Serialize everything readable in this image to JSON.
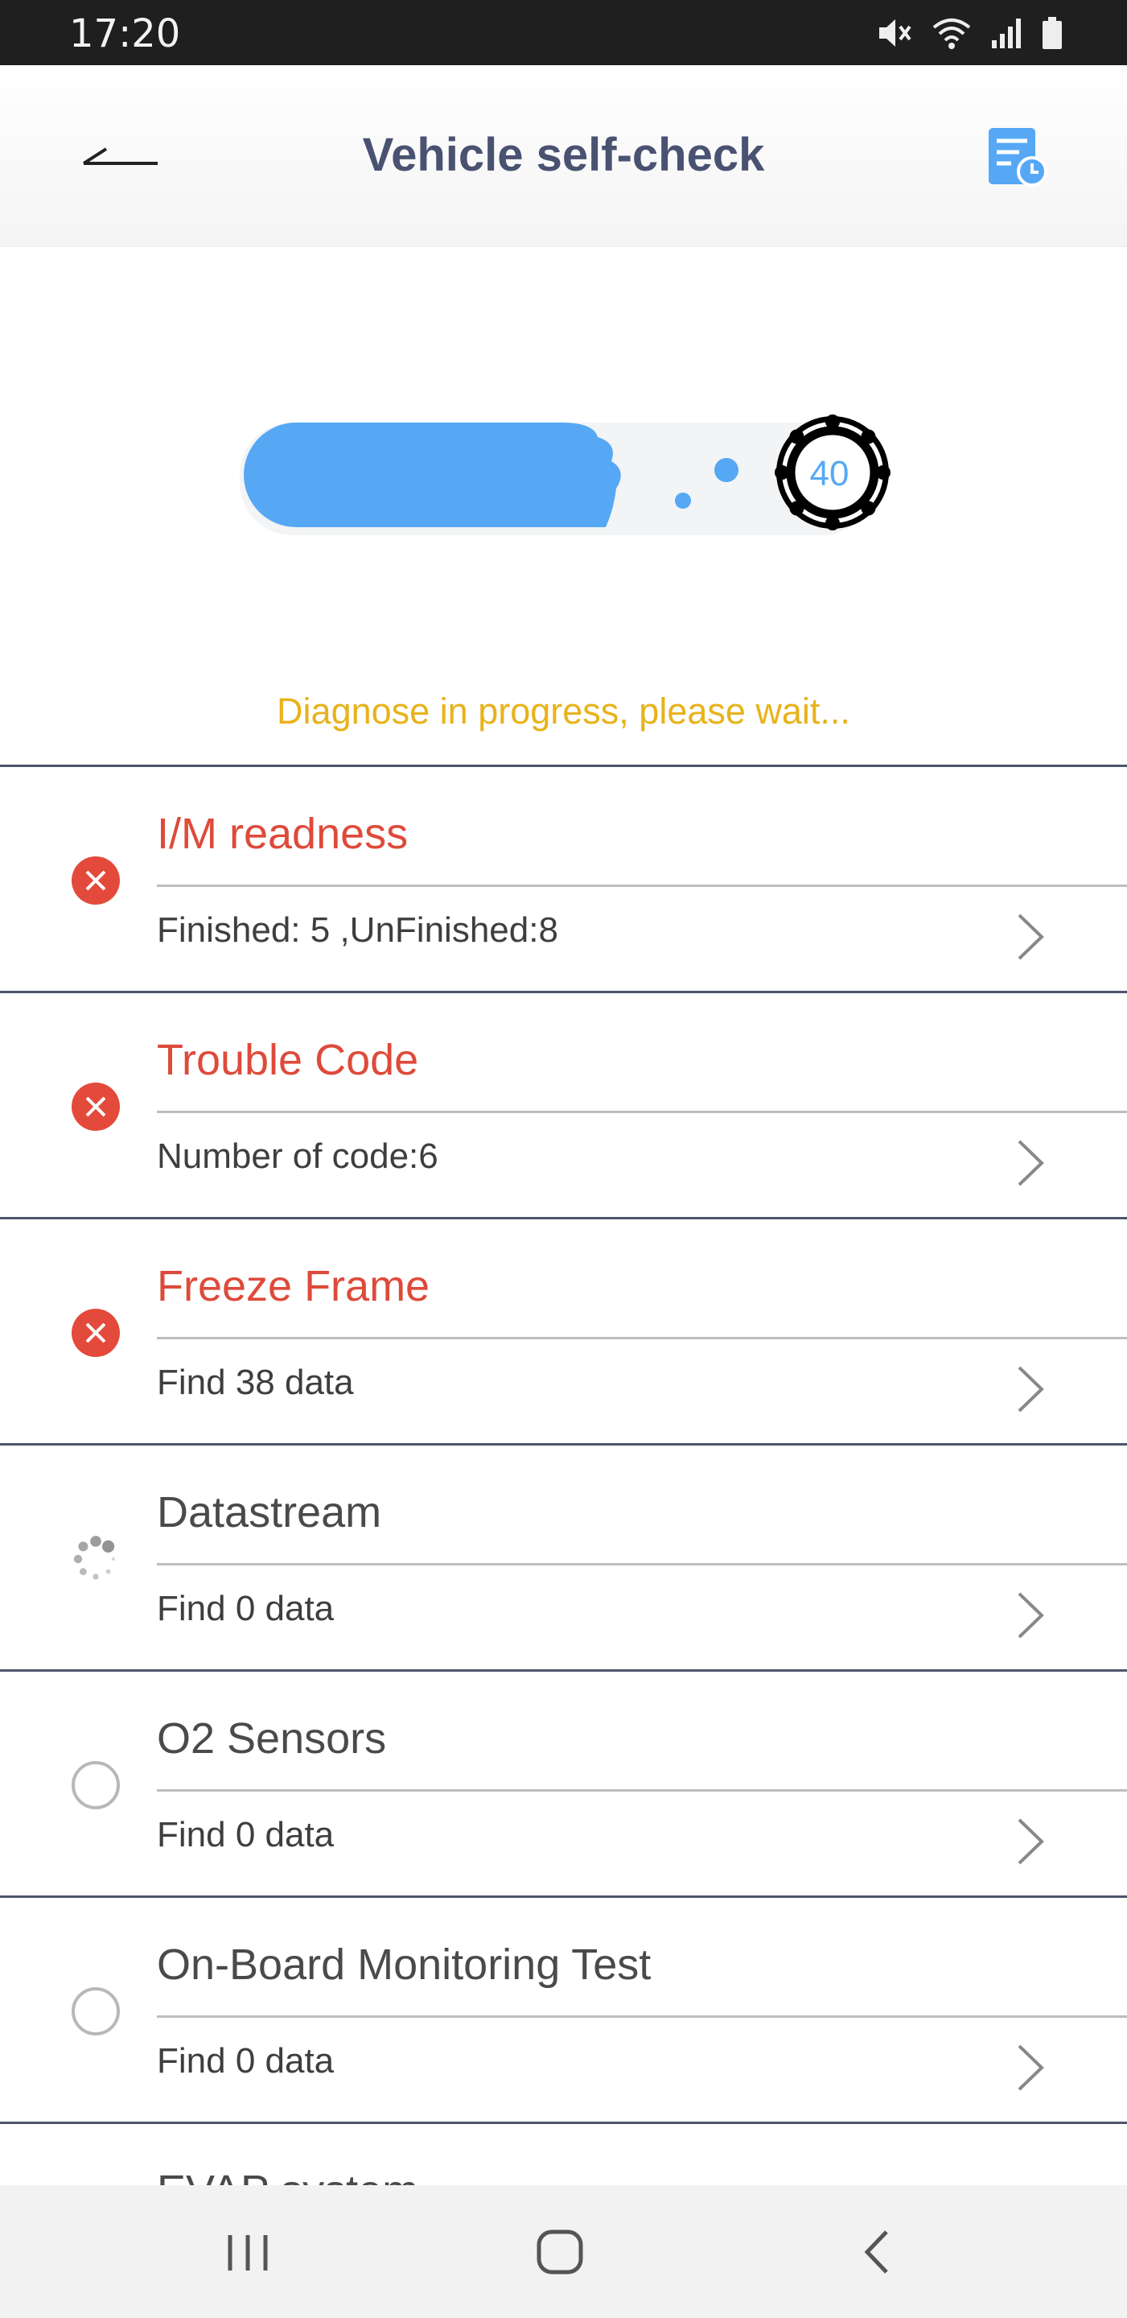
{
  "status_bar": {
    "time": "17:20",
    "icons": [
      "mute-icon",
      "wifi-icon",
      "signal-icon",
      "battery-icon"
    ]
  },
  "header": {
    "title": "Vehicle self-check",
    "back_icon": "back-arrow-icon",
    "report_icon": "report-history-icon"
  },
  "progress": {
    "value": 40,
    "fraction": 0.4,
    "status_text": "Diagnose in progress, please wait..."
  },
  "colors": {
    "accent_blue": "#56a8f5",
    "error_red": "#e34a3b",
    "title_navy": "#4a5272",
    "progress_text": "#e8b21a",
    "divider": "#4c546c"
  },
  "items": [
    {
      "title": "I/M readness",
      "subtitle": "Finished: 5 ,UnFinished:8",
      "status": "error"
    },
    {
      "title": "Trouble Code",
      "subtitle": "Number of code:6",
      "status": "error"
    },
    {
      "title": "Freeze Frame",
      "subtitle": "Find 38 data",
      "status": "error"
    },
    {
      "title": "Datastream",
      "subtitle": "Find 0 data",
      "status": "loading"
    },
    {
      "title": "O2 Sensors",
      "subtitle": "Find 0 data",
      "status": "pending"
    },
    {
      "title": "On-Board Monitoring Test",
      "subtitle": "Find 0 data",
      "status": "pending"
    },
    {
      "title": "EVAP system",
      "subtitle": "",
      "status": "pending"
    }
  ],
  "nav": {
    "recent_icon": "recent-apps-icon",
    "home_icon": "home-icon",
    "back_icon": "nav-back-icon"
  }
}
